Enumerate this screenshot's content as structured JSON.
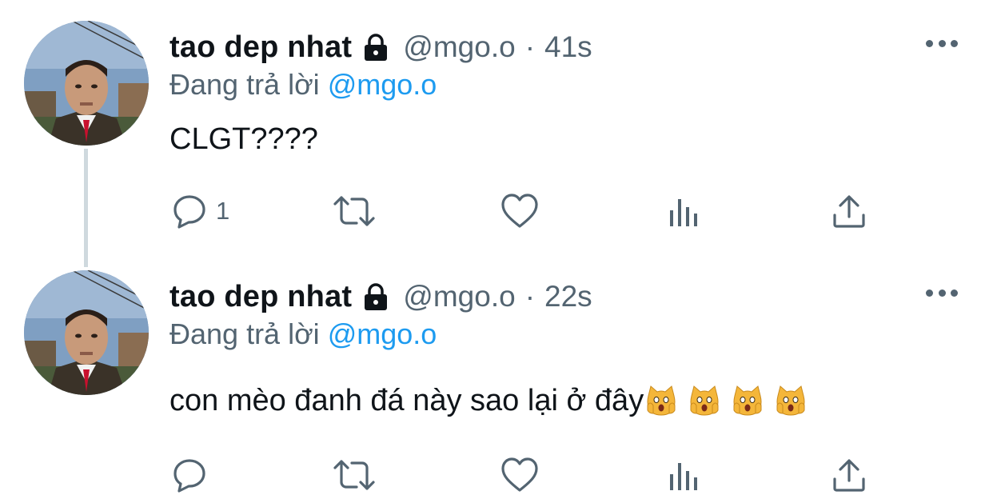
{
  "tweets": [
    {
      "author": {
        "name": "tao dep nhat",
        "handle": "@mgo.o",
        "protected_icon": "lock-icon"
      },
      "separator": "·",
      "time": "41s",
      "replying_prefix": "Đang trả lời",
      "replying_to": "@mgo.o",
      "text": "CLGT????",
      "emojis": [],
      "reply_count": "1"
    },
    {
      "author": {
        "name": "tao dep nhat",
        "handle": "@mgo.o",
        "protected_icon": "lock-icon"
      },
      "separator": "·",
      "time": "22s",
      "replying_prefix": "Đang trả lời",
      "replying_to": "@mgo.o",
      "text": "con mèo đanh đá này sao lại ở đây",
      "emojis": [
        "weary-cat-icon",
        "weary-cat-icon",
        "weary-cat-icon",
        "weary-cat-icon"
      ],
      "reply_count": ""
    }
  ],
  "colors": {
    "text": "#0f1419",
    "secondary": "#536471",
    "link": "#1d9bf0",
    "thread_line": "#cfd9de"
  }
}
